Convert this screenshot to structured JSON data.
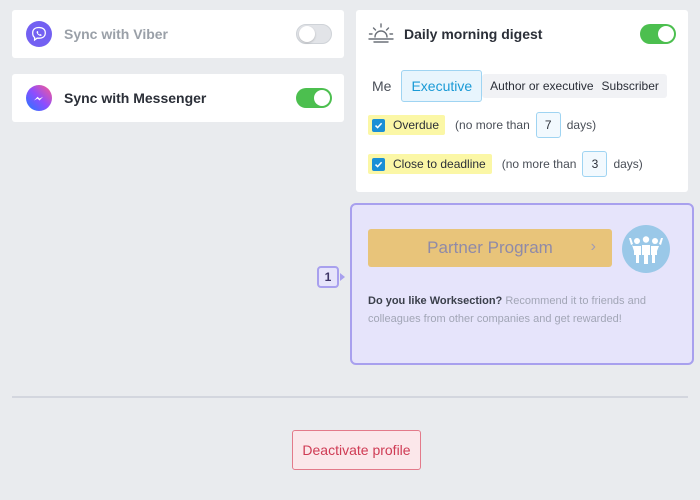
{
  "sync": {
    "viber": {
      "label": "Sync with Viber",
      "enabled": false,
      "icon": "viber-icon",
      "color": "#7360f2"
    },
    "messenger": {
      "label": "Sync with Messenger",
      "enabled": true,
      "icon": "messenger-icon",
      "color": "#2e8bff"
    }
  },
  "digest": {
    "icon": "sunrise-icon",
    "title": "Daily morning digest",
    "enabled": true,
    "tabs": {
      "me": "Me",
      "executive": "Executive",
      "author_or_executive": "Author or executive",
      "subscriber": "Subscriber",
      "selected": "Executive"
    },
    "overdue": {
      "label": "Overdue",
      "checked": true,
      "prefix": "(no more than",
      "value": "7",
      "suffix": "days)"
    },
    "deadline": {
      "label": "Close to deadline",
      "checked": true,
      "prefix": "(no more than",
      "value": "3",
      "suffix": "days)"
    }
  },
  "partner": {
    "button_label": "Partner Program",
    "chevron": "›",
    "avatar_icon": "people-group-icon",
    "question": "Do you like Worksection?",
    "description": " Recommend it to friends and colleagues from other companies and get rewarded!"
  },
  "badge": {
    "number": "1"
  },
  "deactivate": {
    "label": "Deactivate profile"
  },
  "colors": {
    "accent_blue": "#1a9ad6",
    "toggle_on": "#4cbf4f",
    "danger": "#cf3b54",
    "highlight": "#fbf7a6",
    "partner_border": "#a8a0ee"
  }
}
